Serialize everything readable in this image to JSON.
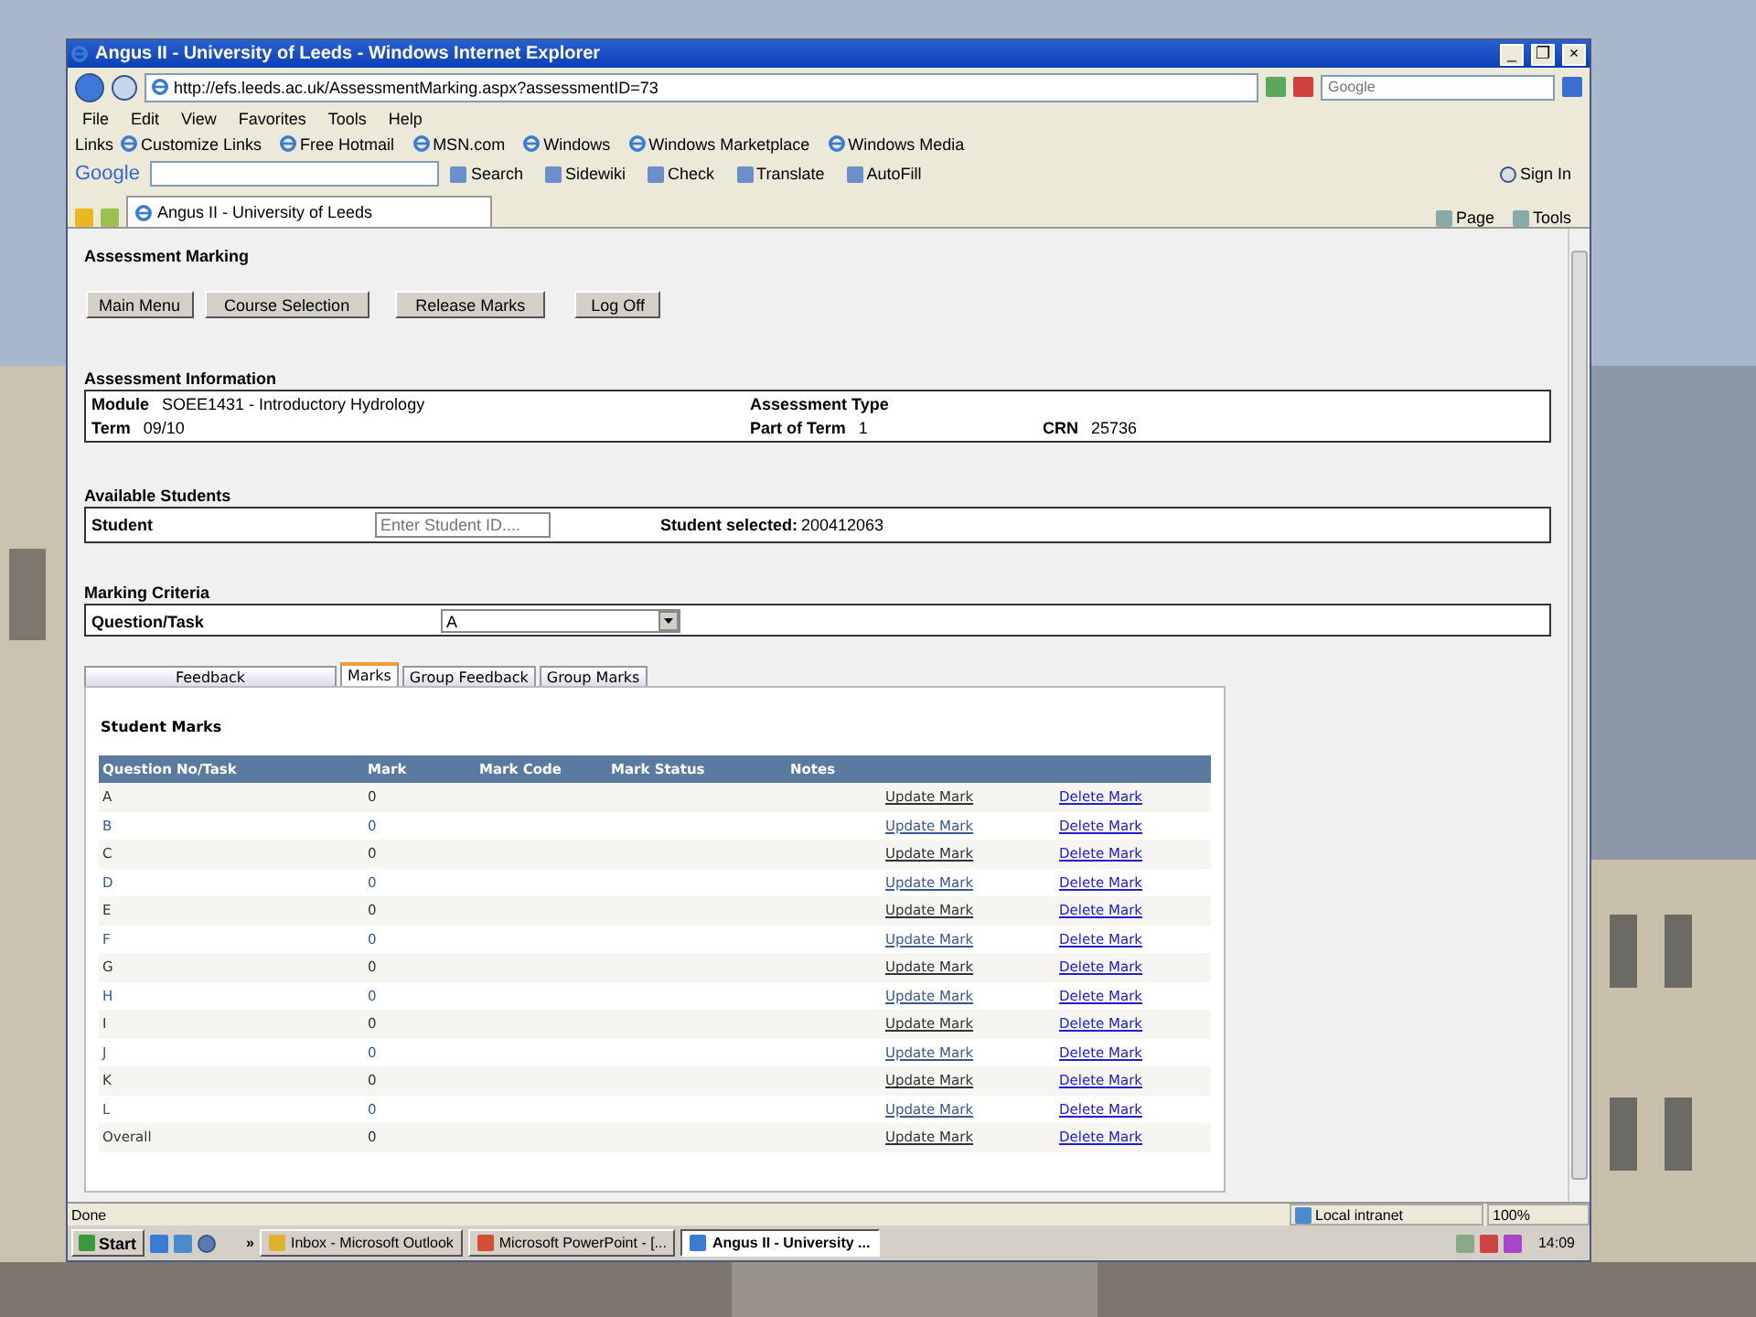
{
  "window": {
    "title": "Angus II - University of Leeds - Windows Internet Explorer",
    "controls": [
      "_",
      "❐",
      "×"
    ]
  },
  "address_bar": {
    "url": "http://efs.leeds.ac.uk/AssessmentMarking.aspx?assessmentID=73",
    "search_placeholder": "Google"
  },
  "menu": [
    "File",
    "Edit",
    "View",
    "Favorites",
    "Tools",
    "Help"
  ],
  "links_bar": {
    "label": "Links",
    "items": [
      "Customize Links",
      "Free Hotmail",
      "MSN.com",
      "Windows",
      "Windows Marketplace",
      "Windows Media"
    ]
  },
  "google_toolbar": {
    "logo": "Google",
    "items": [
      "Search",
      "Sidewiki",
      "Check",
      "Translate",
      "AutoFill"
    ],
    "sign_in": "Sign In"
  },
  "browser_tabs": [
    {
      "label": "Angus II - University of Leeds",
      "selected": true
    }
  ],
  "command_bar": [
    "Page",
    "Tools"
  ],
  "page": {
    "title": "Assessment Marking",
    "buttons": [
      "Main Menu",
      "Course Selection",
      "Release Marks",
      "Log Off"
    ],
    "assessment_info": {
      "heading": "Assessment Information",
      "module_label": "Module",
      "module": "SOEE1431 - Introductory Hydrology",
      "type_label": "Assessment Type",
      "term_label": "Term",
      "term": "09/10",
      "part_label": "Part of Term",
      "part": "1",
      "crn_label": "CRN",
      "crn": "25736"
    },
    "students": {
      "heading": "Available Students",
      "student_label": "Student",
      "placeholder": "Enter Student ID....",
      "selected_label": "Student selected:",
      "selected_id": "200412063"
    },
    "criteria": {
      "heading": "Marking Criteria",
      "label": "Question/Task",
      "value": "A"
    },
    "tabs": [
      {
        "label": "Feedback",
        "selected": false
      },
      {
        "label": "Marks",
        "selected": true
      },
      {
        "label": "Group Feedback",
        "selected": false
      },
      {
        "label": "Group Marks",
        "selected": false
      }
    ],
    "marks": {
      "heading": "Student Marks",
      "columns": [
        "Question No/Task",
        "Mark",
        "Mark Code",
        "Mark Status",
        "Notes"
      ],
      "rows": [
        {
          "task": "A",
          "mark": "0",
          "update": "Update Mark",
          "delete": "Delete Mark"
        },
        {
          "task": "B",
          "mark": "0",
          "update": "Update Mark",
          "delete": "Delete Mark"
        },
        {
          "task": "C",
          "mark": "0",
          "update": "Update Mark",
          "delete": "Delete Mark"
        },
        {
          "task": "D",
          "mark": "0",
          "update": "Update Mark",
          "delete": "Delete Mark"
        },
        {
          "task": "E",
          "mark": "0",
          "update": "Update Mark",
          "delete": "Delete Mark"
        },
        {
          "task": "F",
          "mark": "0",
          "update": "Update Mark",
          "delete": "Delete Mark"
        },
        {
          "task": "G",
          "mark": "0",
          "update": "Update Mark",
          "delete": "Delete Mark"
        },
        {
          "task": "H",
          "mark": "0",
          "update": "Update Mark",
          "delete": "Delete Mark"
        },
        {
          "task": "I",
          "mark": "0",
          "update": "Update Mark",
          "delete": "Delete Mark"
        },
        {
          "task": "J",
          "mark": "0",
          "update": "Update Mark",
          "delete": "Delete Mark"
        },
        {
          "task": "K",
          "mark": "0",
          "update": "Update Mark",
          "delete": "Delete Mark"
        },
        {
          "task": "L",
          "mark": "0",
          "update": "Update Mark",
          "delete": "Delete Mark"
        },
        {
          "task": "Overall",
          "mark": "0",
          "update": "Update Mark",
          "delete": "Delete Mark"
        }
      ]
    }
  },
  "status_bar": {
    "text": "Done",
    "zone": "Local intranet",
    "zoom": "100%"
  },
  "taskbar": {
    "start": "Start",
    "chevron": "»",
    "tasks": [
      {
        "label": "Inbox - Microsoft Outlook",
        "selected": false
      },
      {
        "label": "Microsoft PowerPoint - [...",
        "selected": false
      },
      {
        "label": "Angus II - University ...",
        "selected": true
      }
    ],
    "clock": "14:09"
  }
}
